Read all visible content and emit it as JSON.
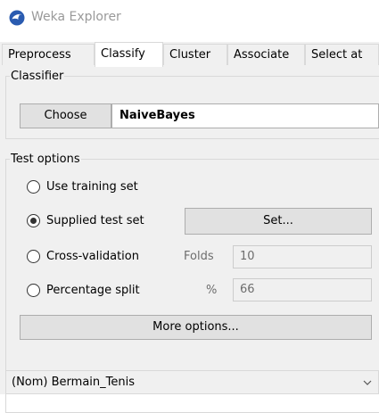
{
  "window": {
    "title": "Weka Explorer",
    "icon": "weka-bird-icon"
  },
  "tabs": [
    {
      "label": "Preprocess",
      "active": false
    },
    {
      "label": "Classify",
      "active": true
    },
    {
      "label": "Cluster",
      "active": false
    },
    {
      "label": "Associate",
      "active": false
    },
    {
      "label": "Select at",
      "active": false
    }
  ],
  "classifier": {
    "legend": "Classifier",
    "choose_label": "Choose",
    "name": "NaiveBayes"
  },
  "test_options": {
    "legend": "Test options",
    "use_training_set": {
      "label": "Use training set",
      "checked": false
    },
    "supplied_test_set": {
      "label": "Supplied test set",
      "checked": true,
      "set_button": "Set..."
    },
    "cross_validation": {
      "label": "Cross-validation",
      "checked": false,
      "folds_label": "Folds",
      "folds_value": "10"
    },
    "percentage_split": {
      "label": "Percentage split",
      "checked": false,
      "pct_label": "%",
      "pct_value": "66"
    },
    "more_options_label": "More options..."
  },
  "class_attribute": {
    "selected": "(Nom) Bermain_Tenis"
  },
  "colors": {
    "panel": "#f0f0f0",
    "button": "#e1e1e1",
    "border": "#adadad",
    "muted_text": "#6d6d6d",
    "icon_blue": "#2a5bb0"
  }
}
